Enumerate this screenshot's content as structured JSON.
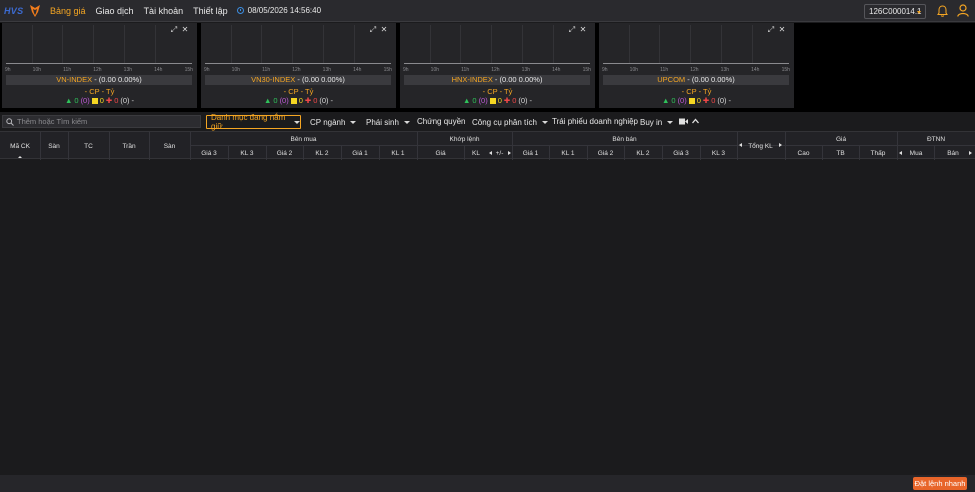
{
  "header": {
    "logo": "HVS",
    "nav": [
      "Bảng giá",
      "Giao dịch",
      "Tài khoản",
      "Thiết lập"
    ],
    "datetime": "08/05/2026 14:56:40",
    "account": "126C000014.1"
  },
  "panels": [
    {
      "name": "VN-INDEX",
      "value": " - (0.00 0.00%)",
      "cp": "- CP - Tỷ",
      "up": "0",
      "ceil": "(0)",
      "ref": "0",
      "down": "0",
      "floor": "(0)",
      "tail": "-"
    },
    {
      "name": "VN30-INDEX",
      "value": " - (0.00 0.00%)",
      "cp": "- CP - Tỷ",
      "up": "0",
      "ceil": "(0)",
      "ref": "0",
      "down": "0",
      "floor": "(0)",
      "tail": "-"
    },
    {
      "name": "HNX-INDEX",
      "value": " - (0.00 0.00%)",
      "cp": "- CP - Tỷ",
      "up": "0",
      "ceil": "(0)",
      "ref": "0",
      "down": "0",
      "floor": "(0)",
      "tail": "-"
    },
    {
      "name": "UPCOM",
      "value": " - (0.00 0.00%)",
      "cp": "- CP - Tỷ",
      "up": "0",
      "ceil": "(0)",
      "ref": "0",
      "down": "0",
      "floor": "(0)",
      "tail": "-"
    }
  ],
  "chart_times": [
    "9h",
    "10h",
    "11h",
    "12h",
    "13h",
    "14h",
    "15h"
  ],
  "toolbar": {
    "search_placeholder": "Thêm hoặc Tìm kiếm",
    "watchlist": "Danh mục đang nắm giữ",
    "sector": "CP ngành",
    "derivatives": "Phái sinh",
    "warrants": "Chứng quyền",
    "analysis": "Công cụ phân tích",
    "bonds": "Trái phiếu doanh nghiệp",
    "buyin": "Buy in"
  },
  "table": {
    "ma_ck": "Mã CK",
    "san": "Sàn",
    "tc": "TC",
    "tran": "Trần",
    "san2": "Sàn",
    "ben_mua": "Bên mua",
    "khop_lenh": "Khớp lệnh",
    "ben_ban": "Bên bán",
    "tong_kl": "Tổng KL",
    "gia": "Giá",
    "dtnn": "ĐTNN",
    "buy_cols": [
      "Giá 3",
      "KL 3",
      "Giá 2",
      "KL 2",
      "Giá 1",
      "KL 1"
    ],
    "match_cols": [
      "Giá",
      "KL",
      "+/-"
    ],
    "sell_cols": [
      "Giá 1",
      "KL 1",
      "Giá 2",
      "KL 2",
      "Giá 3",
      "KL 3"
    ],
    "price_cols": [
      "Cao",
      "TB",
      "Thấp"
    ],
    "foreign_cols": [
      "Mua",
      "Bán"
    ]
  },
  "footer": {
    "quick_order": "Đặt lệnh nhanh"
  }
}
